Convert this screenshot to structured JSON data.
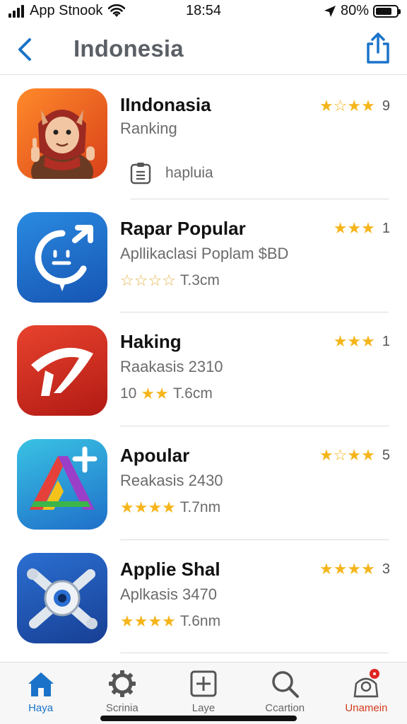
{
  "status_bar": {
    "carrier": "App Stnook",
    "time": "18:54",
    "battery_percent": "80%",
    "battery_level": 0.8
  },
  "nav": {
    "back_icon": "chevron-left-icon",
    "title": "Indonesia",
    "share_icon": "share-icon"
  },
  "apps": [
    {
      "name": "IIndonasia",
      "subtitle": "Ranking",
      "meta_icon": "clipboard-icon",
      "meta_text": "hapluia",
      "right_stars": "★☆★★",
      "right_count": "9"
    },
    {
      "name": "Rapar Popular",
      "subtitle": "Apllikaclasi Poplam $BD",
      "meta_stars": "☆☆☆☆",
      "meta_text": "T.3cm",
      "right_stars": "★★★",
      "right_count": "1"
    },
    {
      "name": "Haking",
      "subtitle": "Raakasis 2310",
      "meta_prefix": "10",
      "meta_stars": "★★",
      "meta_text": "T.6cm",
      "right_stars": "★★★",
      "right_count": "1"
    },
    {
      "name": "Apoular",
      "subtitle": "Reakasis 2430",
      "meta_stars": "★★★★",
      "meta_text": "T.7nm",
      "right_stars": "★☆★★",
      "right_count": "5"
    },
    {
      "name": "Applie Shal",
      "subtitle": "Aplkasis 3470",
      "meta_stars": "★★★★",
      "meta_text": "T.6nm",
      "right_stars": "★★★★",
      "right_count": "3"
    }
  ],
  "tabs": [
    {
      "label": "Haya",
      "icon": "home-icon"
    },
    {
      "label": "Scrinia",
      "icon": "gear-icon"
    },
    {
      "label": "Laye",
      "icon": "add-square-icon"
    },
    {
      "label": "Ccartion",
      "icon": "search-icon"
    },
    {
      "label": "Unamein",
      "icon": "profile-notification-icon"
    }
  ],
  "colors": {
    "accent": "#1a73c9",
    "star": "#f5b51b",
    "alert": "#d33a1b"
  }
}
